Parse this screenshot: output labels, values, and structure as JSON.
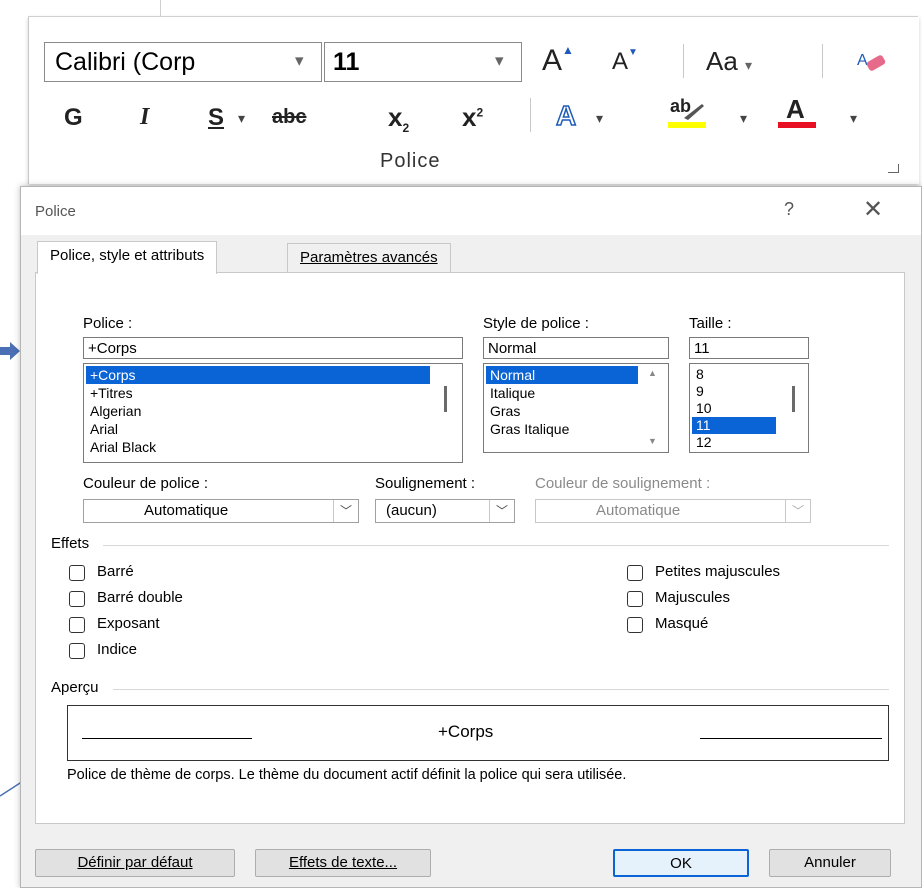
{
  "ribbon": {
    "font_name": "Calibri (Corp",
    "font_size": "11",
    "group_label": "Police",
    "icons": [
      "grow-font-icon",
      "shrink-font-icon",
      "change-case-icon",
      "clear-formatting-icon",
      "bold-icon",
      "italic-icon",
      "underline-icon",
      "strikethrough-icon",
      "subscript-icon",
      "superscript-icon",
      "text-effects-icon",
      "highlight-icon",
      "font-color-icon"
    ],
    "bold_glyph": "G",
    "italic_glyph": "I",
    "underline_glyph": "S",
    "strike_glyph": "abc",
    "sub_glyph": "x",
    "sub_small": "2",
    "sup_glyph": "x",
    "sup_small": "2",
    "case_glyph": "Aa",
    "grow_glyph": "A",
    "shrink_glyph": "A",
    "effects_glyph": "A",
    "highlight_glyph": "ab",
    "fontcolor_glyph": "A",
    "highlight_color": "#ffff00",
    "font_color": "#e81123"
  },
  "dialog": {
    "title": "Police",
    "help": "?",
    "close": "✕",
    "tabs": {
      "active": "Police, style et attributs",
      "inactive": "Paramètres avancés"
    },
    "font": {
      "label": "Police :",
      "value": "+Corps",
      "items": [
        "+Corps",
        "+Titres",
        "Algerian",
        "Arial",
        "Arial Black"
      ],
      "selected": "+Corps"
    },
    "style": {
      "label": "Style de police :",
      "value": "Normal",
      "items": [
        "Normal",
        "Italique",
        "Gras",
        "Gras Italique"
      ],
      "selected": "Normal"
    },
    "size": {
      "label": "Taille :",
      "value": "11",
      "items": [
        "8",
        "9",
        "10",
        "11",
        "12"
      ],
      "selected": "11"
    },
    "font_color": {
      "label": "Couleur de police :",
      "value": "Automatique"
    },
    "underline": {
      "label": "Soulignement :",
      "value": "(aucun)"
    },
    "underline_color": {
      "label": "Couleur de soulignement :",
      "value": "Automatique"
    },
    "effects": {
      "title": "Effets",
      "left": [
        "Barré",
        "Barré double",
        "Exposant",
        "Indice"
      ],
      "right": [
        "Petites majuscules",
        "Majuscules",
        "Masqué"
      ]
    },
    "preview": {
      "title": "Aperçu",
      "sample": "+Corps",
      "description": "Police de thème de corps. Le thème du document actif définit la police qui sera utilisée."
    },
    "buttons": {
      "default": "Définir par défaut",
      "effects": "Effets de texte...",
      "ok": "OK",
      "cancel": "Annuler"
    }
  },
  "colors": {
    "selection": "#0a64d6",
    "arrow": "#4a6fb5"
  }
}
